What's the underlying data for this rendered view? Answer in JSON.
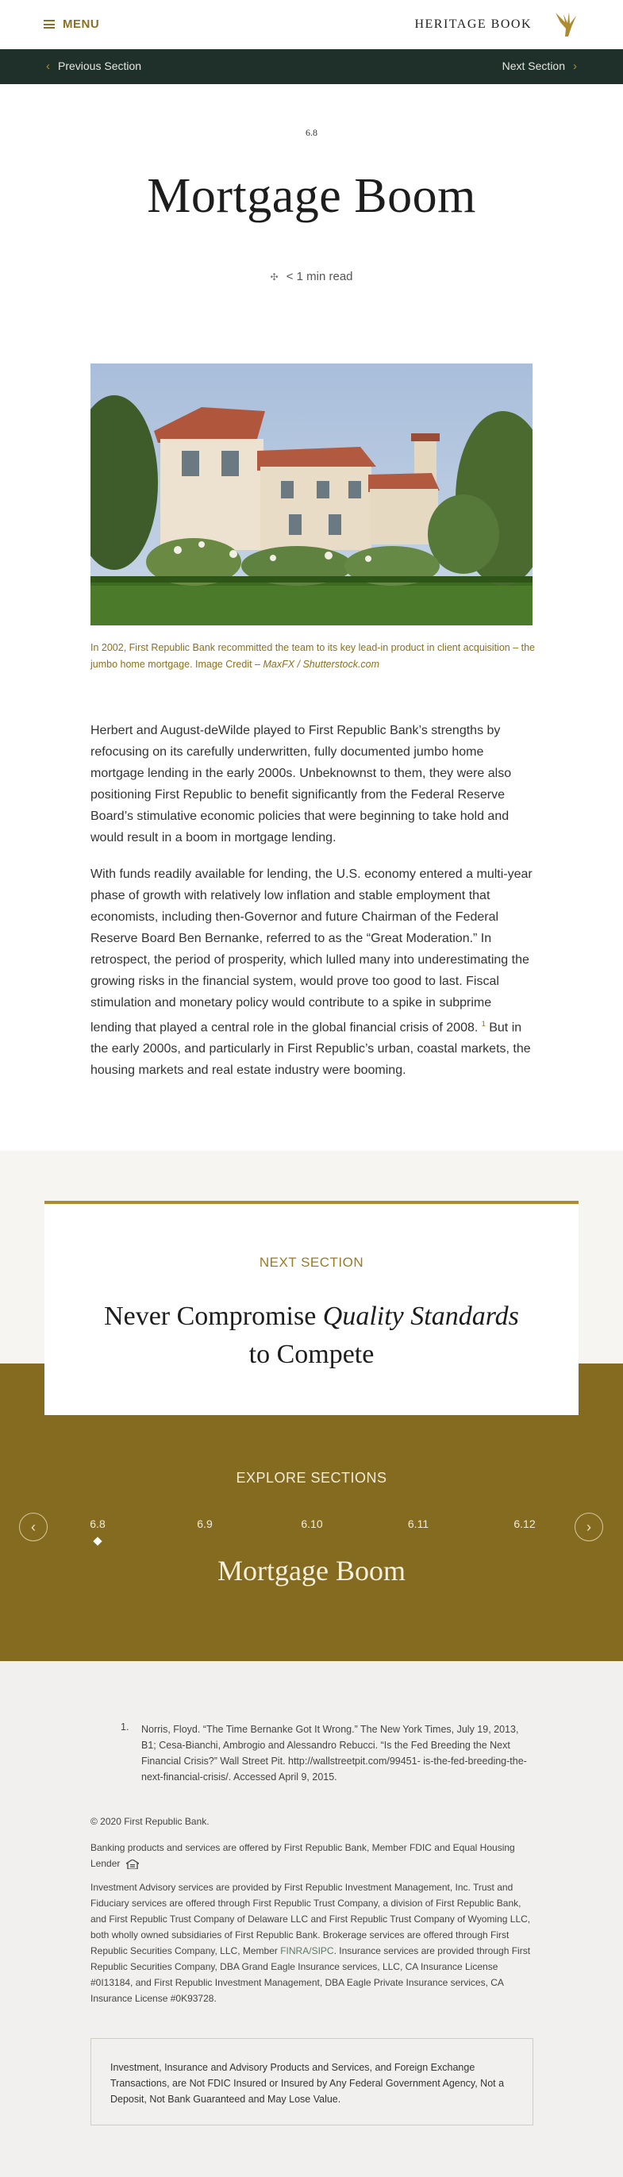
{
  "header": {
    "menu_label": "MENU",
    "brand": "HERITAGE BOOK",
    "logo_icon": "eagle-icon"
  },
  "nav": {
    "prev_label": "Previous Section",
    "next_label": "Next Section"
  },
  "article": {
    "section_number": "6.8",
    "title": "Mortgage Boom",
    "read_time": "< 1 min read",
    "caption_text": "In 2002, First Republic Bank recommitted the team to its key lead-in product in client acquisition – the jumbo home mortgage. Image Credit – ",
    "caption_credit": "MaxFX / Shutterstock.com",
    "paragraph1": "Herbert and August-deWilde played to First Republic Bank’s strengths by refocusing on its carefully underwritten, fully documented jumbo home mortgage lending in the early 2000s. Unbeknownst to them, they were also positioning First Republic to benefit significantly from the Federal Reserve Board’s stimulative economic policies that were beginning to take hold and would result in a boom in mortgage lending.",
    "paragraph2_a": "With funds readily available for lending, the U.S. economy entered a multi-year phase of growth with relatively low inflation and stable employment that economists, including then-Governor and future Chairman of the Federal Reserve Board Ben Bernanke, referred to as the “Great Moderation.” In retrospect, the period of prosperity, which lulled many into underestimating the growing risks in the financial system, would prove too good to last. Fiscal stimulation and monetary policy would contribute to a spike in subprime lending that played a central role in the global financial crisis of 2008.",
    "footnote_ref": "1",
    "paragraph2_b": " But in the early 2000s, and particularly in First Republic’s urban, coastal markets, the housing markets and real estate industry were booming."
  },
  "next_section": {
    "label": "NEXT SECTION",
    "title_a": "Never Compromise ",
    "title_italic": "Quality Standards",
    "title_b": "to Compete"
  },
  "explore": {
    "label": "EXPLORE SECTIONS",
    "prev_icon": "chevron-left-icon",
    "next_icon": "chevron-right-icon",
    "sections": [
      "6.8",
      "6.9",
      "6.10",
      "6.11",
      "6.12"
    ],
    "active": "6.8",
    "active_title": "Mortgage Boom"
  },
  "footer": {
    "footnote_number": "1.",
    "footnote_text": "Norris, Floyd. “The Time Bernanke Got It Wrong.” The New York Times, July 19, 2013, B1; Cesa-Bianchi, Ambrogio and Alessandro Rebucci. “Is the Fed Breeding the Next Financial Crisis?” Wall Street Pit. http://wallstreetpit.com/99451- is-the-fed-breeding-the-next-financial-crisis/. Accessed April 9, 2015.",
    "copyright": "© 2020 First Republic Bank.",
    "banking": "Banking products and services are offered by First Republic Bank, Member FDIC and Equal Housing Lender",
    "invest_a": "Investment Advisory services are provided by First Republic Investment Management, Inc. Trust and Fiduciary services are offered through First Republic Trust Company, a division of First Republic Bank, and First Republic Trust Company of Delaware LLC and First Republic Trust Company of Wyoming LLC, both wholly owned subsidiaries of First Republic Bank. Brokerage services are offered through First Republic Securities Company, LLC, Member ",
    "finra": "FINRA",
    "slash": "/",
    "sipc": "SIPC",
    "invest_b": ". Insurance services are provided through First Republic Securities Company, DBA Grand Eagle Insurance services, LLC, CA Insurance License #0I13184, and First Republic Investment Management, DBA Eagle Private Insurance services, CA Insurance License #0K93728.",
    "disclaimer": "Investment, Insurance and Advisory Products and Services, and Foreign Exchange Transactions, are Not FDIC Insured or Insured by Any Federal Government Agency, Not a Deposit, Not Bank Guaranteed and May Lose Value."
  },
  "colors": {
    "gold": "#846b20",
    "dark_green": "#1e3029",
    "accent_text": "#8a7020"
  }
}
